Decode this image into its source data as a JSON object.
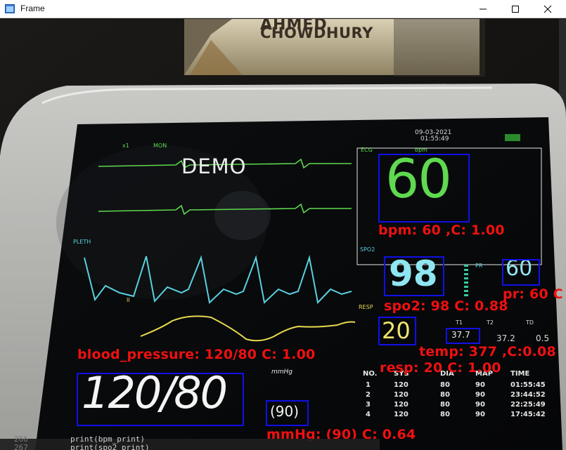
{
  "window": {
    "title": "Frame"
  },
  "book_cover": {
    "line1": "AHMED",
    "line2": "CHOWDHURY"
  },
  "monitor": {
    "date": "09-03-2021",
    "time": "01:55:49",
    "demo_text": "DEMO",
    "labels": {
      "ecg": "ECG",
      "bpm": "bpm",
      "x1": "x1",
      "mon": "MON",
      "pleth": "PLETH",
      "ii": "II",
      "spo2": "SPO2",
      "pr": "PR",
      "resp": "RESP",
      "t1": "T1",
      "t2": "T2",
      "td": "TD",
      "mmhg": "mmHg"
    },
    "hr_value": "60",
    "spo2_value": "98",
    "pr_value": "60",
    "resp_value": "20",
    "temp_value": "37.7",
    "temp_t2": "37.2",
    "temp_td": "0.5",
    "bp_value": "120/80",
    "map_value": "(90)",
    "nibp_table": {
      "headers": [
        "NO.",
        "SYS",
        "DIA",
        "MAP",
        "TIME"
      ],
      "rows": [
        [
          "1",
          "120",
          "80",
          "90",
          "01:55:45"
        ],
        [
          "2",
          "120",
          "80",
          "90",
          "23:44:52"
        ],
        [
          "3",
          "120",
          "80",
          "90",
          "22:25:49"
        ],
        [
          "4",
          "120",
          "80",
          "90",
          "17:45:42"
        ]
      ]
    }
  },
  "detections": {
    "bpm": "bpm: 60 ,C: 1.00",
    "spo2": "spo2: 98 C:  0.88",
    "pr": "pr: 60 C",
    "resp": "resp: 20 C:  1.00",
    "temp": "temp: 377 ,C:0.08",
    "blood_pressure": "blood_pressure: 120/80  C: 1.00",
    "mmhg": "mmHg: (90) C:  0.64"
  },
  "code_lines": {
    "ln1": "266",
    "ln2": "267",
    "line1": "print(bpm_print)",
    "line2": "print(spo2_print)"
  },
  "colors": {
    "detection_box": "#1010e8",
    "detection_text": "#f01010",
    "ecg": "#5fd94f",
    "pleth": "#5ad0e0",
    "resp": "#e8d850"
  }
}
